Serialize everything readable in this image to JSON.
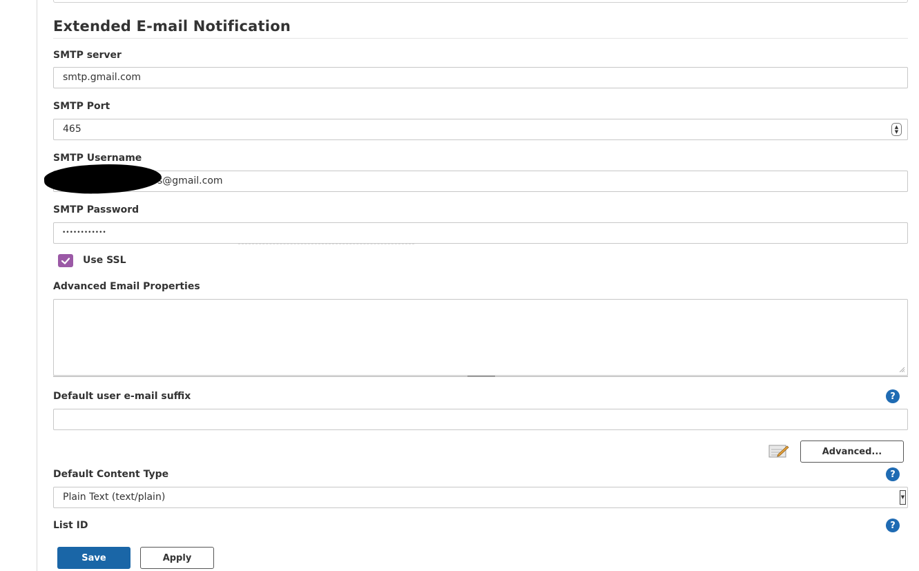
{
  "section": {
    "title": "Extended E-mail Notification"
  },
  "smtp_server": {
    "label": "SMTP server",
    "value": "smtp.gmail.com"
  },
  "smtp_port": {
    "label": "SMTP Port",
    "value": "465"
  },
  "smtp_username": {
    "label": "SMTP Username",
    "value_visible_part": "s@gmail.com"
  },
  "smtp_password": {
    "label": "SMTP Password",
    "value_masked": "••••••••••••"
  },
  "use_ssl": {
    "label": "Use SSL",
    "checked": true
  },
  "advanced_email_properties": {
    "label": "Advanced Email Properties",
    "value": ""
  },
  "default_suffix": {
    "label": "Default user e-mail suffix",
    "value": ""
  },
  "advanced_button": {
    "label": "Advanced..."
  },
  "default_content_type": {
    "label": "Default Content Type",
    "selected": "Plain Text (text/plain)"
  },
  "list_id": {
    "label": "List ID"
  },
  "help_icon_glyph": "?",
  "buttons": {
    "save": "Save",
    "apply": "Apply"
  },
  "colors": {
    "primary_button": "#1a66a7",
    "checkbox": "#9b59a6",
    "help_icon": "#1f6bb3"
  },
  "icons": [
    "spinner-icon",
    "checkmark-icon",
    "help-icon",
    "notepad-edit-icon",
    "select-arrow-icon",
    "resize-grip-icon"
  ]
}
